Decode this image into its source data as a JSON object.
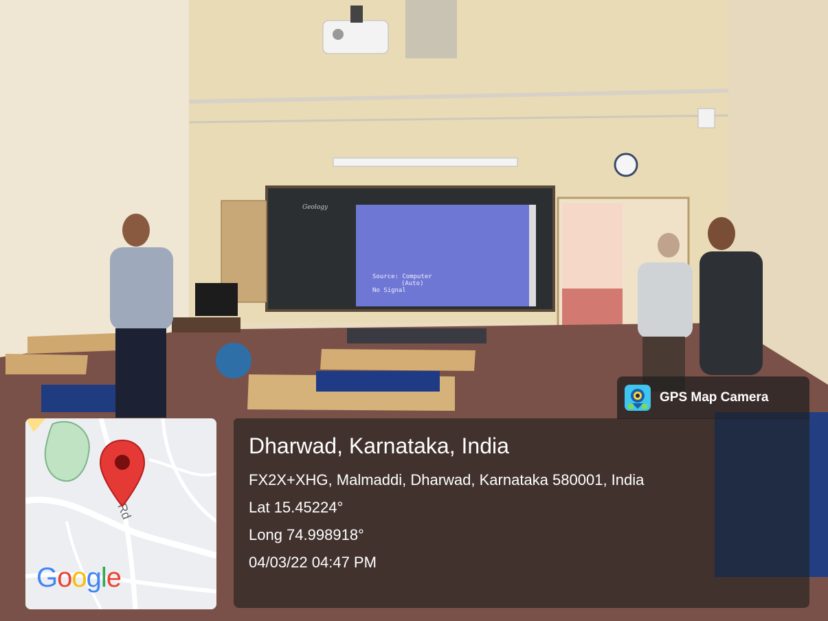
{
  "badge": {
    "label": "GPS Map Camera",
    "icon": "camera-pin-icon"
  },
  "location": {
    "place": "Dharwad, Karnataka, India",
    "address": "FX2X+XHG, Malmaddi, Dharwad, Karnataka 580001, India",
    "lat": "Lat 15.45224°",
    "long": "Long 74.998918°",
    "datetime": "04/03/22 04:47 PM"
  },
  "map": {
    "road_label": "Rd",
    "logo": "Google",
    "pin_icon": "map-pin-icon",
    "pin_color": "#e53935"
  },
  "screen": {
    "line1": "Source: Computer",
    "line2": "(Auto)",
    "line3": "No Signal"
  },
  "blackboard": {
    "text": "Geology"
  }
}
